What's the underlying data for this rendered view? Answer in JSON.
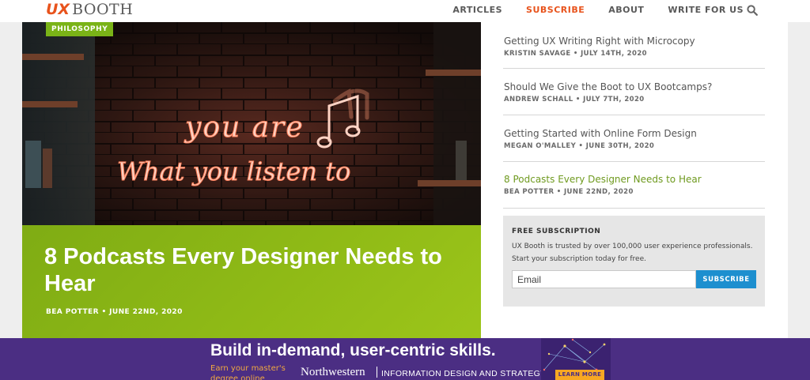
{
  "header": {
    "logo": {
      "ux": "UX",
      "booth": "BOOTH"
    },
    "nav": [
      {
        "label": "ARTICLES"
      },
      {
        "label": "SUBSCRIBE"
      },
      {
        "label": "ABOUT"
      },
      {
        "label": "WRITE FOR US"
      }
    ],
    "search_icon": "search-icon"
  },
  "feature": {
    "category": "PHILOSOPHY",
    "neon_line1": "you are",
    "neon_line2": "What you listen to",
    "title": "8 Podcasts Every Designer Needs to Hear",
    "meta": "BEA POTTER • JUNE 22ND, 2020"
  },
  "articles": [
    {
      "title": "Getting UX Writing Right with Microcopy",
      "meta": "KRISTIN SAVAGE • JULY 14TH, 2020"
    },
    {
      "title": "Should We Give the Boot to UX Bootcamps?",
      "meta": "ANDREW SCHALL • JULY 7TH, 2020"
    },
    {
      "title": "Getting Started with Online Form Design",
      "meta": "MEGAN O'MALLEY • JUNE 30TH, 2020"
    },
    {
      "title": "8 Podcasts Every Designer Needs to Hear",
      "meta": "BEA POTTER • JUNE 22ND, 2020"
    }
  ],
  "subscription": {
    "heading": "FREE SUBSCRIPTION",
    "text": "UX Booth is trusted by over 100,000 user experience professionals. Start your subscription today for free.",
    "input_placeholder": "Email",
    "button_label": "SUBSCRIBE"
  },
  "ad": {
    "headline": "Build in-demand, user-centric skills.",
    "subline": "Earn your master's degree online",
    "school": "Northwestern",
    "program": "INFORMATION DESIGN AND STRATEGY",
    "cta": "LEARN MORE"
  },
  "colors": {
    "brand_orange": "#e8531c",
    "feature_green": "#8fba16",
    "active_link_green": "#6f9a1f",
    "subscribe_blue": "#1d8fcf",
    "ad_purple": "#4b2e83"
  }
}
